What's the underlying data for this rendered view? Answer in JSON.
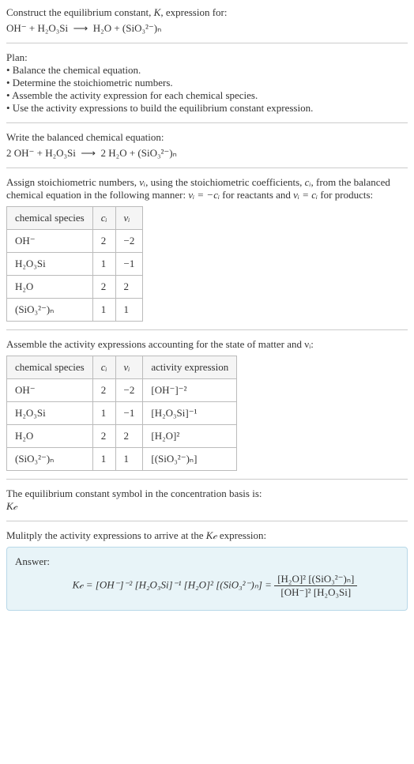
{
  "intro": {
    "line1": "Construct the equilibrium constant, ",
    "K": "K",
    "line1b": ", expression for:"
  },
  "eq1": {
    "lhs": "OH⁻ + H₂O₃Si",
    "arrow": "⟶",
    "rhs": "H₂O + (SiO₃²⁻)ₙ"
  },
  "plan": {
    "title": "Plan:",
    "b1": "• Balance the chemical equation.",
    "b2": "• Determine the stoichiometric numbers.",
    "b3": "• Assemble the activity expression for each chemical species.",
    "b4": "• Use the activity expressions to build the equilibrium constant expression."
  },
  "balanced": {
    "title": "Write the balanced chemical equation:",
    "lhs": "2 OH⁻ + H₂O₃Si",
    "arrow": "⟶",
    "rhs": "2 H₂O + (SiO₃²⁻)ₙ"
  },
  "stoich": {
    "p1": "Assign stoichiometric numbers, ",
    "nu_i": "νᵢ",
    "p2": ", using the stoichiometric coefficients, ",
    "c_i": "cᵢ",
    "p3": ", from the balanced chemical equation in the following manner: ",
    "rel1": "νᵢ = −cᵢ",
    "p4": " for reactants and ",
    "rel2": "νᵢ = cᵢ",
    "p5": " for products:"
  },
  "table1": {
    "h1": "chemical species",
    "h2": "cᵢ",
    "h3": "νᵢ",
    "rows": [
      {
        "sp": "OH⁻",
        "c": "2",
        "nu": "−2"
      },
      {
        "sp": "H₂O₃Si",
        "c": "1",
        "nu": "−1"
      },
      {
        "sp": "H₂O",
        "c": "2",
        "nu": "2"
      },
      {
        "sp": "(SiO₃²⁻)ₙ",
        "c": "1",
        "nu": "1"
      }
    ]
  },
  "activity": {
    "title": "Assemble the activity expressions accounting for the state of matter and νᵢ:"
  },
  "table2": {
    "h1": "chemical species",
    "h2": "cᵢ",
    "h3": "νᵢ",
    "h4": "activity expression",
    "rows": [
      {
        "sp": "OH⁻",
        "c": "2",
        "nu": "−2",
        "act": "[OH⁻]⁻²"
      },
      {
        "sp": "H₂O₃Si",
        "c": "1",
        "nu": "−1",
        "act": "[H₂O₃Si]⁻¹"
      },
      {
        "sp": "H₂O",
        "c": "2",
        "nu": "2",
        "act": "[H₂O]²"
      },
      {
        "sp": "(SiO₃²⁻)ₙ",
        "c": "1",
        "nu": "1",
        "act": "[(SiO₃²⁻)ₙ]"
      }
    ]
  },
  "symbol": {
    "p": "The equilibrium constant symbol in the concentration basis is:",
    "kc": "K𝒸"
  },
  "multiply": {
    "p1": "Mulitply the activity expressions to arrive at the ",
    "kc": "K𝒸",
    "p2": " expression:"
  },
  "answer": {
    "label": "Answer:",
    "lhs": "K𝒸 = [OH⁻]⁻² [H₂O₃Si]⁻¹ [H₂O]² [(SiO₃²⁻)ₙ] = ",
    "num": "[H₂O]² [(SiO₃²⁻)ₙ]",
    "den": "[OH⁻]² [H₂O₃Si]"
  }
}
